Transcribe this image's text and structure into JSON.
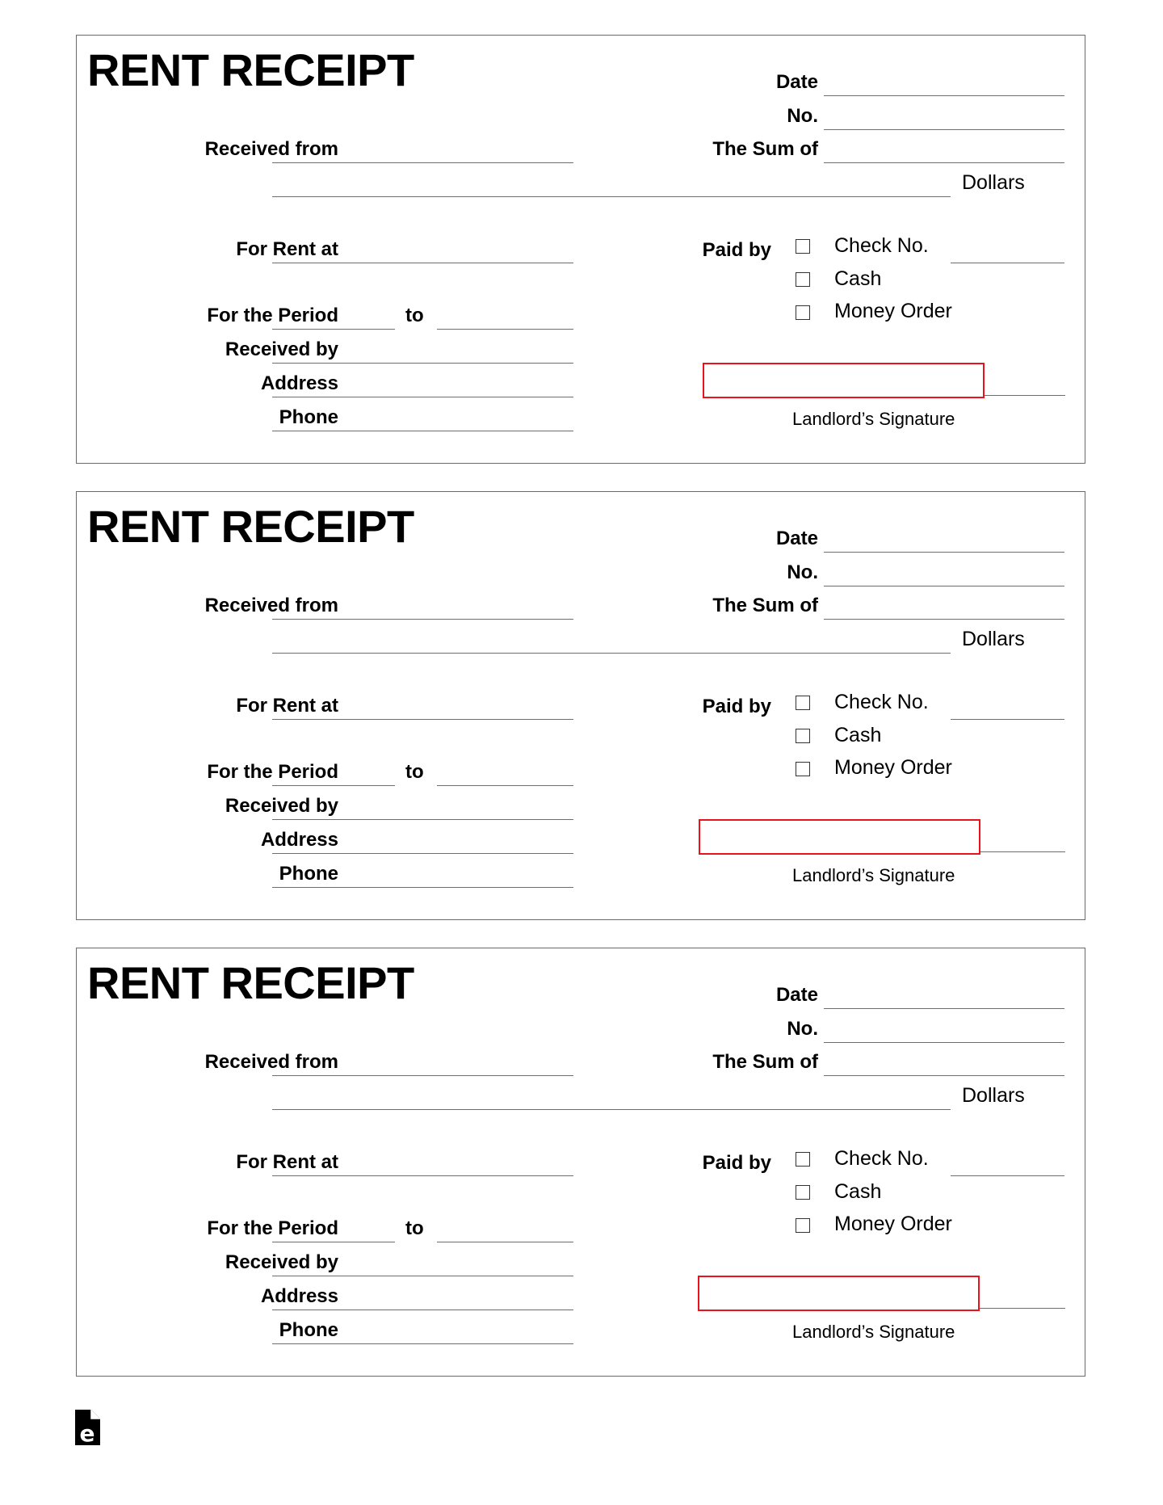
{
  "document": {
    "receipts": [
      {
        "title": "RENT RECEIPT",
        "labels": {
          "date": "Date",
          "no": "No.",
          "sum_of": "The Sum of",
          "dollars": "Dollars",
          "received_from": "Received from",
          "for_rent_at": "For Rent at",
          "for_the_period": "For the Period",
          "to": "to",
          "received_by": "Received by",
          "address": "Address",
          "phone": "Phone",
          "paid_by": "Paid by",
          "check_no": "Check No.",
          "cash": "Cash",
          "money_order": "Money Order",
          "landlord_signature": "Landlord’s Signature"
        },
        "values": {
          "date": "",
          "no": "",
          "sum_of": "",
          "dollars_text": "",
          "received_from": "",
          "for_rent_at": "",
          "period_from": "",
          "period_to": "",
          "received_by": "",
          "address": "",
          "phone": "",
          "check_no": "",
          "signature": ""
        },
        "checkboxes": {
          "check": false,
          "cash": false,
          "money_order": false
        }
      },
      {
        "title": "RENT RECEIPT",
        "labels": {
          "date": "Date",
          "no": "No.",
          "sum_of": "The Sum of",
          "dollars": "Dollars",
          "received_from": "Received from",
          "for_rent_at": "For Rent at",
          "for_the_period": "For the Period",
          "to": "to",
          "received_by": "Received by",
          "address": "Address",
          "phone": "Phone",
          "paid_by": "Paid by",
          "check_no": "Check No.",
          "cash": "Cash",
          "money_order": "Money Order",
          "landlord_signature": "Landlord’s Signature"
        },
        "values": {
          "date": "",
          "no": "",
          "sum_of": "",
          "dollars_text": "",
          "received_from": "",
          "for_rent_at": "",
          "period_from": "",
          "period_to": "",
          "received_by": "",
          "address": "",
          "phone": "",
          "check_no": "",
          "signature": ""
        },
        "checkboxes": {
          "check": false,
          "cash": false,
          "money_order": false
        }
      },
      {
        "title": "RENT RECEIPT",
        "labels": {
          "date": "Date",
          "no": "No.",
          "sum_of": "The Sum of",
          "dollars": "Dollars",
          "received_from": "Received from",
          "for_rent_at": "For Rent at",
          "for_the_period": "For the Period",
          "to": "to",
          "received_by": "Received by",
          "address": "Address",
          "phone": "Phone",
          "paid_by": "Paid by",
          "check_no": "Check No.",
          "cash": "Cash",
          "money_order": "Money Order",
          "landlord_signature": "Landlord’s Signature"
        },
        "values": {
          "date": "",
          "no": "",
          "sum_of": "",
          "dollars_text": "",
          "received_from": "",
          "for_rent_at": "",
          "period_from": "",
          "period_to": "",
          "received_by": "",
          "address": "",
          "phone": "",
          "check_no": "",
          "signature": ""
        },
        "checkboxes": {
          "check": false,
          "cash": false,
          "money_order": false
        }
      }
    ],
    "signature_highlight_color": "#e8141c",
    "footer_logo": {
      "icon": "document-e-logo-icon",
      "glyph": "e"
    }
  }
}
